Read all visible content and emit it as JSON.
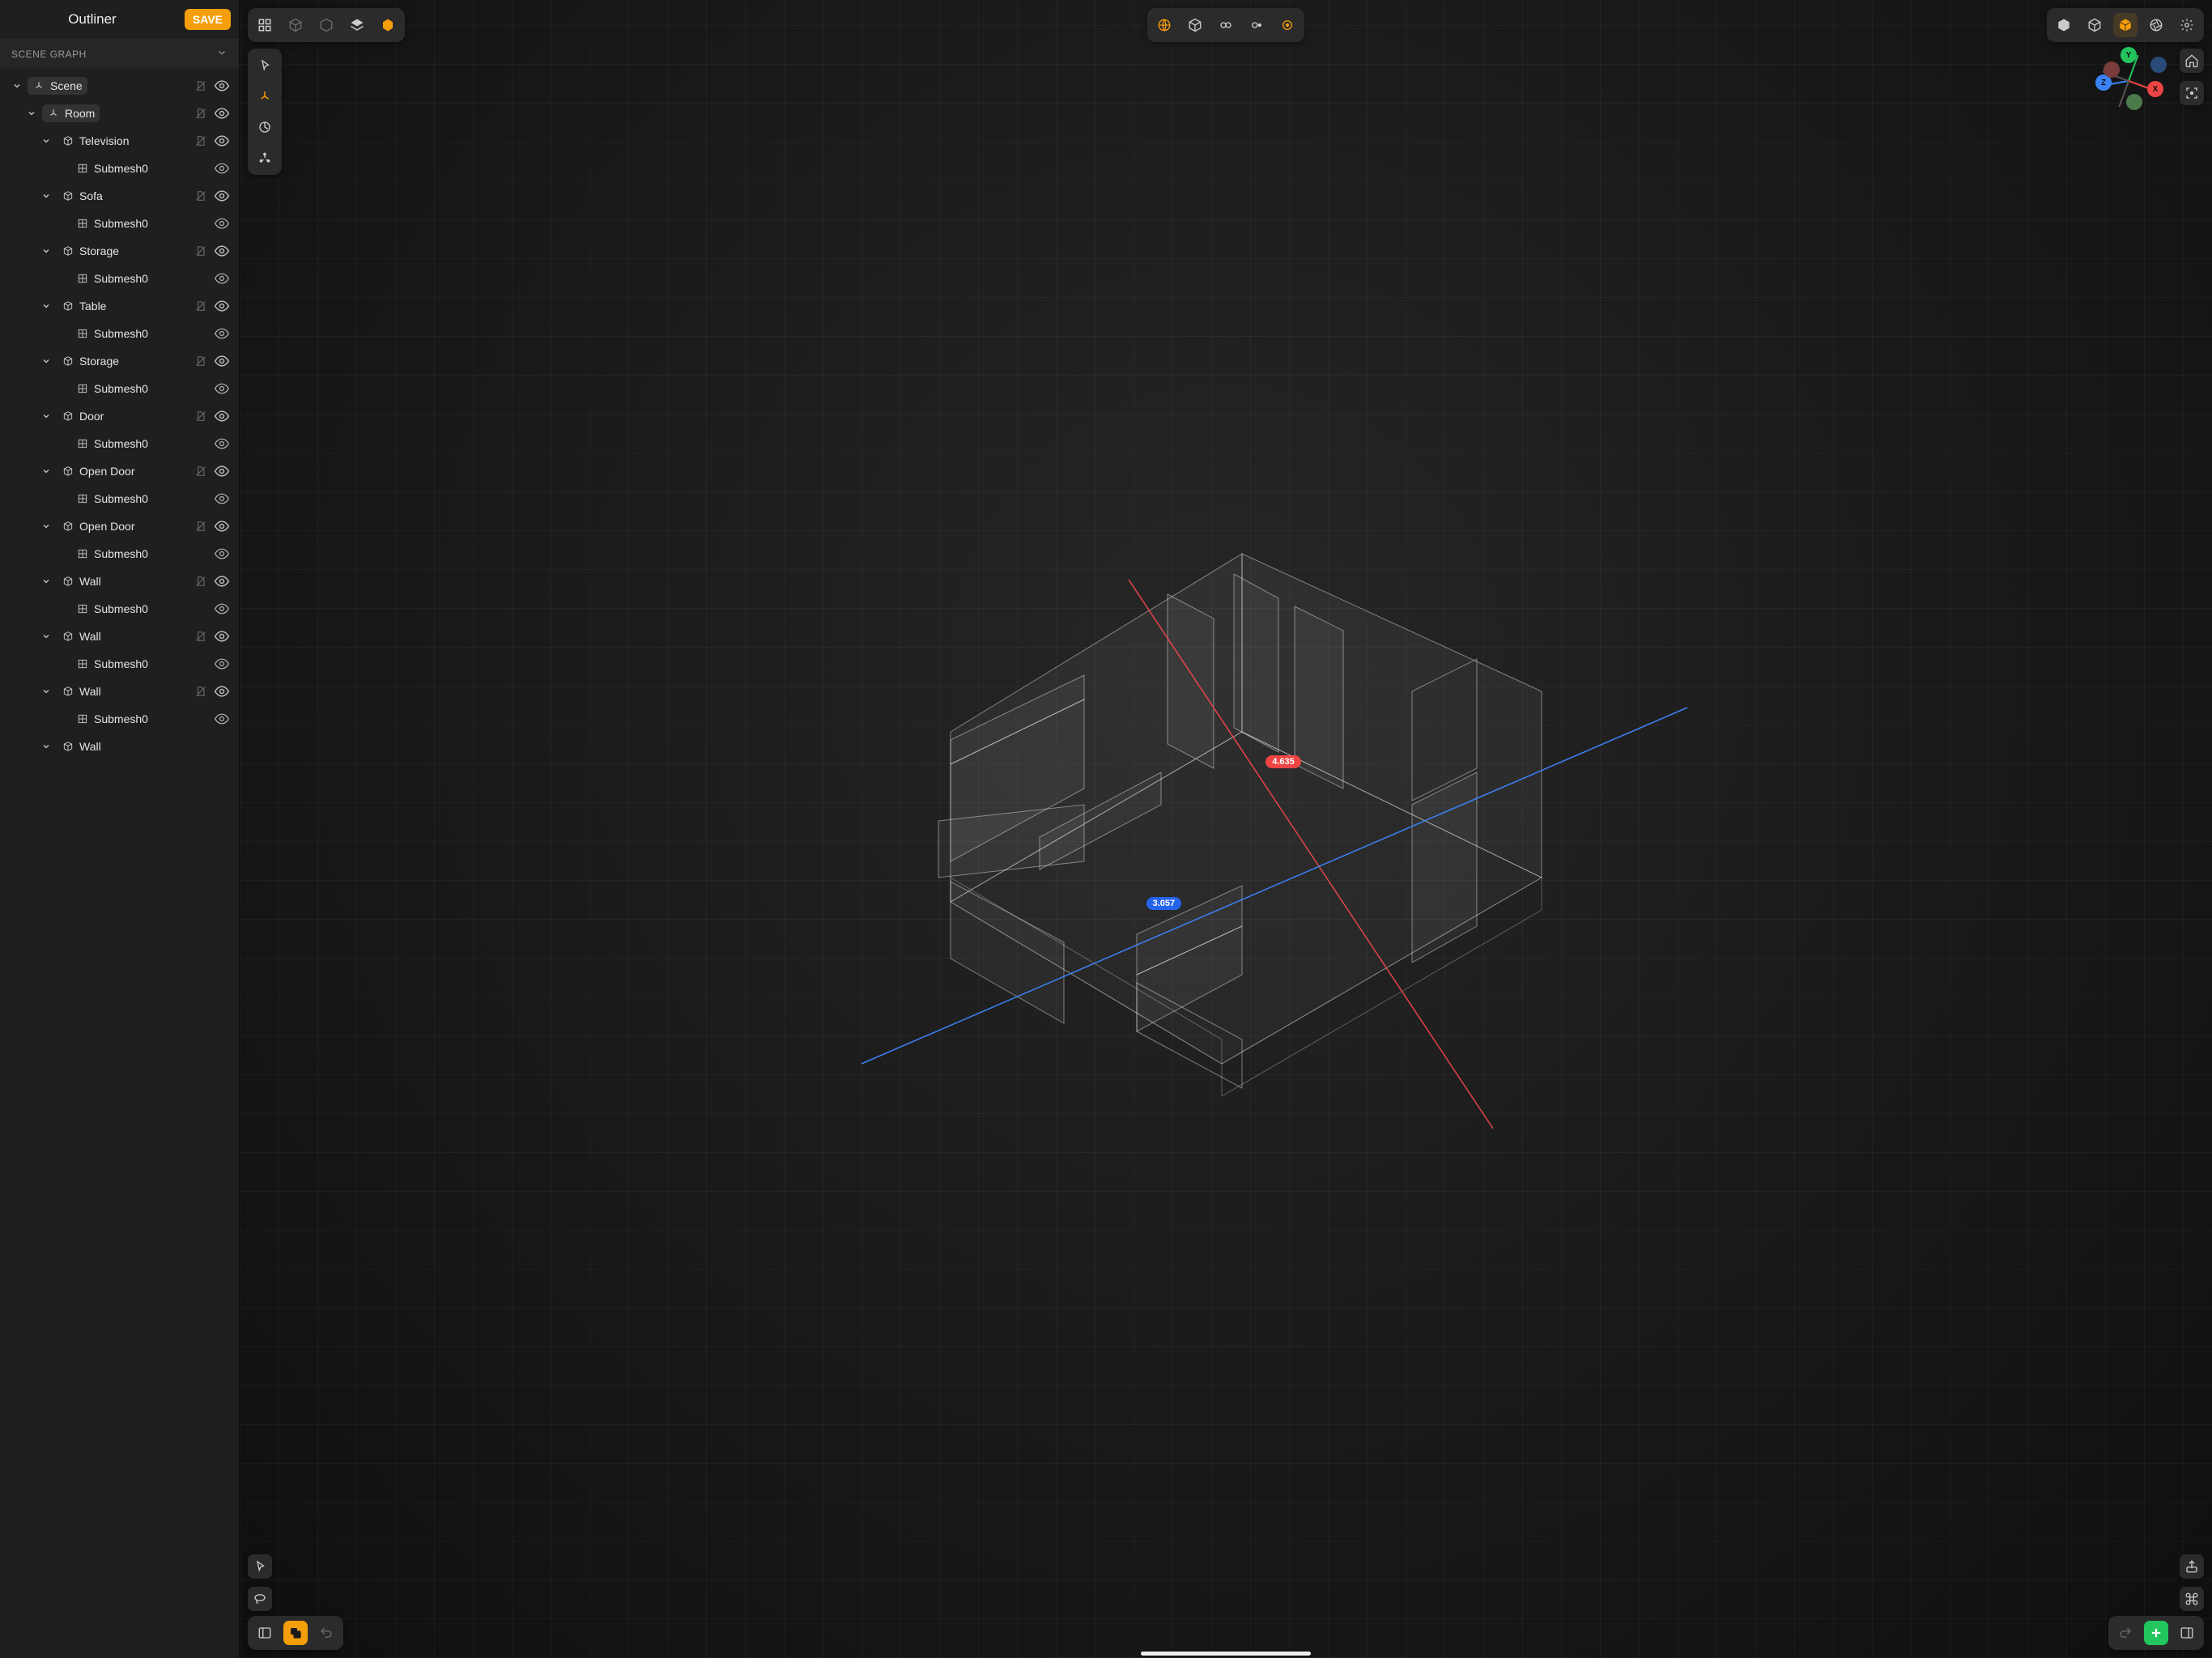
{
  "sidebar": {
    "title": "Outliner",
    "save_label": "SAVE",
    "section_label": "SCENE GRAPH"
  },
  "tree": [
    {
      "depth": 0,
      "expand": true,
      "icon": "axes",
      "boxed": true,
      "name": "Scene",
      "muted": true,
      "eye": true
    },
    {
      "depth": 1,
      "expand": true,
      "icon": "axes",
      "boxed": true,
      "name": "Room",
      "muted": true,
      "eye": true
    },
    {
      "depth": 2,
      "expand": true,
      "icon": "cube3",
      "boxed": false,
      "name": "Television",
      "muted": true,
      "eye": true
    },
    {
      "depth": 3,
      "expand": false,
      "icon": "grid",
      "boxed": false,
      "name": "Submesh0",
      "muted": false,
      "eye": "simple"
    },
    {
      "depth": 2,
      "expand": true,
      "icon": "cube3",
      "boxed": false,
      "name": "Sofa",
      "muted": true,
      "eye": true
    },
    {
      "depth": 3,
      "expand": false,
      "icon": "grid",
      "boxed": false,
      "name": "Submesh0",
      "muted": false,
      "eye": "simple"
    },
    {
      "depth": 2,
      "expand": true,
      "icon": "cube3",
      "boxed": false,
      "name": "Storage",
      "muted": true,
      "eye": true
    },
    {
      "depth": 3,
      "expand": false,
      "icon": "grid",
      "boxed": false,
      "name": "Submesh0",
      "muted": false,
      "eye": "simple"
    },
    {
      "depth": 2,
      "expand": true,
      "icon": "cube3",
      "boxed": false,
      "name": "Table",
      "muted": true,
      "eye": true
    },
    {
      "depth": 3,
      "expand": false,
      "icon": "grid",
      "boxed": false,
      "name": "Submesh0",
      "muted": false,
      "eye": "simple"
    },
    {
      "depth": 2,
      "expand": true,
      "icon": "cube3",
      "boxed": false,
      "name": "Storage",
      "muted": true,
      "eye": true
    },
    {
      "depth": 3,
      "expand": false,
      "icon": "grid",
      "boxed": false,
      "name": "Submesh0",
      "muted": false,
      "eye": "simple"
    },
    {
      "depth": 2,
      "expand": true,
      "icon": "cube3",
      "boxed": false,
      "name": "Door",
      "muted": true,
      "eye": true
    },
    {
      "depth": 3,
      "expand": false,
      "icon": "grid",
      "boxed": false,
      "name": "Submesh0",
      "muted": false,
      "eye": "simple"
    },
    {
      "depth": 2,
      "expand": true,
      "icon": "cube3",
      "boxed": false,
      "name": "Open Door",
      "muted": true,
      "eye": true
    },
    {
      "depth": 3,
      "expand": false,
      "icon": "grid",
      "boxed": false,
      "name": "Submesh0",
      "muted": false,
      "eye": "simple"
    },
    {
      "depth": 2,
      "expand": true,
      "icon": "cube3",
      "boxed": false,
      "name": "Open Door",
      "muted": true,
      "eye": true
    },
    {
      "depth": 3,
      "expand": false,
      "icon": "grid",
      "boxed": false,
      "name": "Submesh0",
      "muted": false,
      "eye": "simple"
    },
    {
      "depth": 2,
      "expand": true,
      "icon": "cube3",
      "boxed": false,
      "name": "Wall",
      "muted": true,
      "eye": true
    },
    {
      "depth": 3,
      "expand": false,
      "icon": "grid",
      "boxed": false,
      "name": "Submesh0",
      "muted": false,
      "eye": "simple"
    },
    {
      "depth": 2,
      "expand": true,
      "icon": "cube3",
      "boxed": false,
      "name": "Wall",
      "muted": true,
      "eye": true
    },
    {
      "depth": 3,
      "expand": false,
      "icon": "grid",
      "boxed": false,
      "name": "Submesh0",
      "muted": false,
      "eye": "simple"
    },
    {
      "depth": 2,
      "expand": true,
      "icon": "cube3",
      "boxed": false,
      "name": "Wall",
      "muted": true,
      "eye": true
    },
    {
      "depth": 3,
      "expand": false,
      "icon": "grid",
      "boxed": false,
      "name": "Submesh0",
      "muted": false,
      "eye": "simple"
    },
    {
      "depth": 2,
      "expand": true,
      "icon": "cube3",
      "boxed": false,
      "name": "Wall",
      "muted": false,
      "eye": false
    }
  ],
  "gizmo": {
    "x": "X",
    "y": "Y",
    "z": "Z"
  },
  "measurements": {
    "x_value": "4.635",
    "z_value": "3.057"
  },
  "colors": {
    "accent": "#f59e0b",
    "axis_x": "#ef4444",
    "axis_y": "#22c55e",
    "axis_z": "#3b82f6"
  }
}
